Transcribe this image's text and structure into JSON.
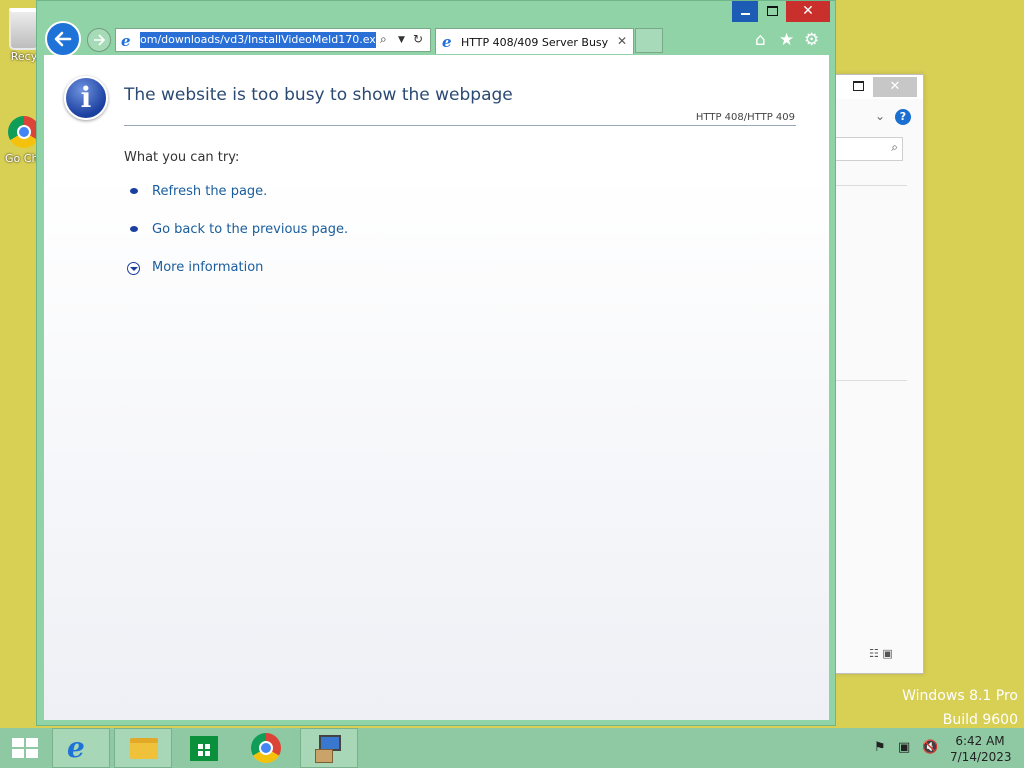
{
  "desktop": {
    "icons": [
      {
        "label": "Recy"
      },
      {
        "label": "Go Chr"
      }
    ],
    "watermark": {
      "line1": "Windows 8.1 Pro",
      "line2": "Build 9600"
    }
  },
  "browser": {
    "address_url": "om/downloads/vd3/InstallVideoMeld170.exe",
    "tab_title": "HTTP 408/409 Server Busy",
    "page": {
      "heading": "The website is too busy to show the webpage",
      "error_code": "HTTP 408/HTTP 409",
      "what_you_can_try": "What you can try:",
      "options": [
        {
          "label": "Refresh the page."
        },
        {
          "label": "Go back to the previous page."
        },
        {
          "label": "More information"
        }
      ]
    }
  },
  "taskbar": {
    "clock": {
      "time": "6:42 AM",
      "date": "7/14/2023"
    }
  },
  "colors": {
    "desktop": "#d8cf55",
    "window_frame": "#8fd3a6",
    "accent_blue": "#1f72d8",
    "close_red": "#c9302c",
    "link": "#1a5d9c"
  }
}
